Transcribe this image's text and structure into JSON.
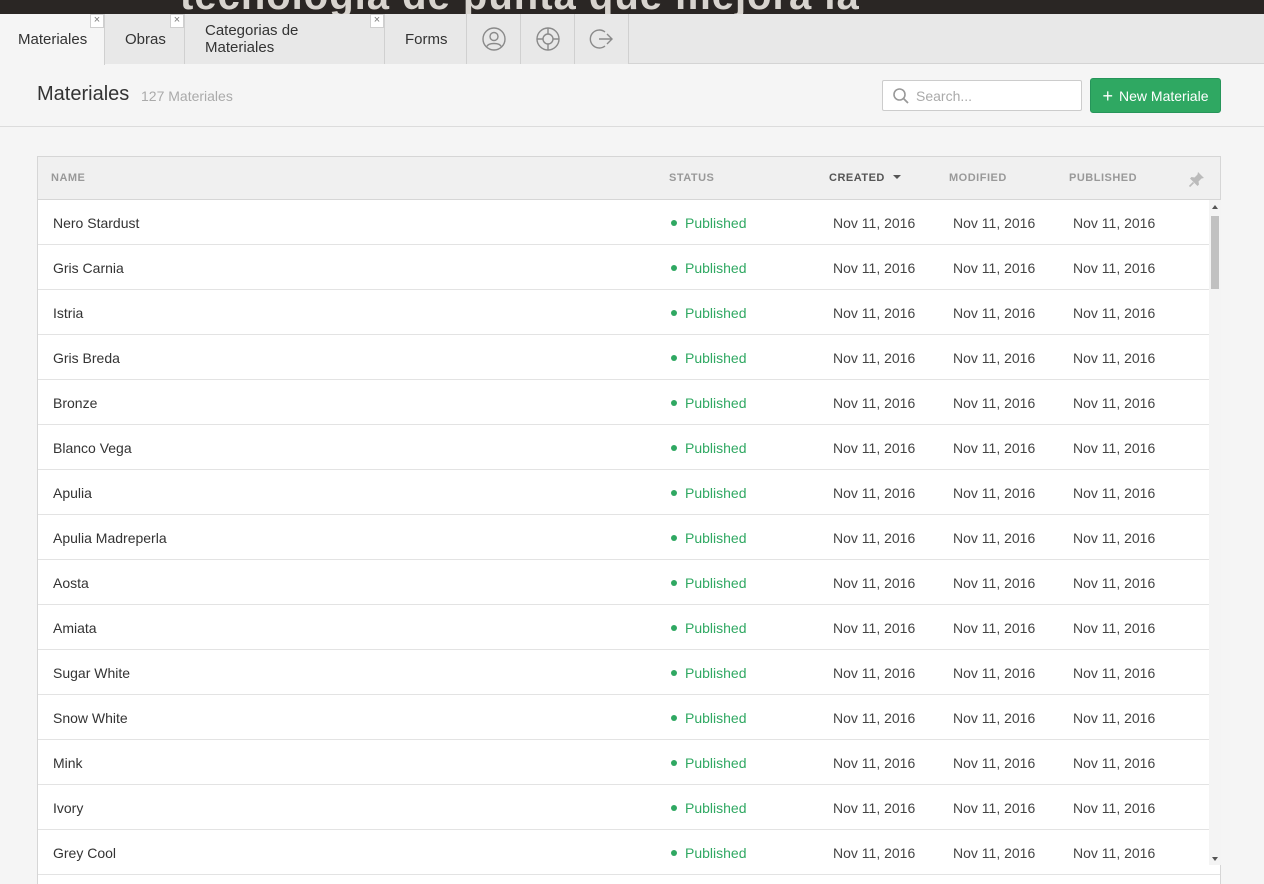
{
  "background_page": {
    "text": "tecnología de punta que mejora la"
  },
  "tabs": [
    {
      "label": "Materiales",
      "active": true,
      "closable": true
    },
    {
      "label": "Obras",
      "active": false,
      "closable": true
    },
    {
      "label": "Categorias de Materiales",
      "active": false,
      "closable": true
    },
    {
      "label": "Forms",
      "active": false,
      "closable": false
    }
  ],
  "tab_icons": [
    "user-icon",
    "help-lifebuoy-icon",
    "sign-out-icon"
  ],
  "header": {
    "title": "Materiales",
    "count": "127 Materiales",
    "search_placeholder": "Search...",
    "new_button": "New Materiale"
  },
  "table": {
    "columns": {
      "name": "NAME",
      "status": "STATUS",
      "created": "CREATED",
      "modified": "MODIFIED",
      "published": "PUBLISHED"
    },
    "sorted_by": "created",
    "rows": [
      {
        "name": "Nero Stardust",
        "status": "Published",
        "created": "Nov 11, 2016",
        "modified": "Nov 11, 2016",
        "published": "Nov 11, 2016"
      },
      {
        "name": "Gris Carnia",
        "status": "Published",
        "created": "Nov 11, 2016",
        "modified": "Nov 11, 2016",
        "published": "Nov 11, 2016"
      },
      {
        "name": "Istria",
        "status": "Published",
        "created": "Nov 11, 2016",
        "modified": "Nov 11, 2016",
        "published": "Nov 11, 2016"
      },
      {
        "name": "Gris Breda",
        "status": "Published",
        "created": "Nov 11, 2016",
        "modified": "Nov 11, 2016",
        "published": "Nov 11, 2016"
      },
      {
        "name": "Bronze",
        "status": "Published",
        "created": "Nov 11, 2016",
        "modified": "Nov 11, 2016",
        "published": "Nov 11, 2016"
      },
      {
        "name": "Blanco Vega",
        "status": "Published",
        "created": "Nov 11, 2016",
        "modified": "Nov 11, 2016",
        "published": "Nov 11, 2016"
      },
      {
        "name": "Apulia",
        "status": "Published",
        "created": "Nov 11, 2016",
        "modified": "Nov 11, 2016",
        "published": "Nov 11, 2016"
      },
      {
        "name": "Apulia Madreperla",
        "status": "Published",
        "created": "Nov 11, 2016",
        "modified": "Nov 11, 2016",
        "published": "Nov 11, 2016"
      },
      {
        "name": "Aosta",
        "status": "Published",
        "created": "Nov 11, 2016",
        "modified": "Nov 11, 2016",
        "published": "Nov 11, 2016"
      },
      {
        "name": "Amiata",
        "status": "Published",
        "created": "Nov 11, 2016",
        "modified": "Nov 11, 2016",
        "published": "Nov 11, 2016"
      },
      {
        "name": "Sugar White",
        "status": "Published",
        "created": "Nov 11, 2016",
        "modified": "Nov 11, 2016",
        "published": "Nov 11, 2016"
      },
      {
        "name": "Snow White",
        "status": "Published",
        "created": "Nov 11, 2016",
        "modified": "Nov 11, 2016",
        "published": "Nov 11, 2016"
      },
      {
        "name": "Mink",
        "status": "Published",
        "created": "Nov 11, 2016",
        "modified": "Nov 11, 2016",
        "published": "Nov 11, 2016"
      },
      {
        "name": "Ivory",
        "status": "Published",
        "created": "Nov 11, 2016",
        "modified": "Nov 11, 2016",
        "published": "Nov 11, 2016"
      },
      {
        "name": "Grey Cool",
        "status": "Published",
        "created": "Nov 11, 2016",
        "modified": "Nov 11, 2016",
        "published": "Nov 11, 2016"
      }
    ]
  },
  "colors": {
    "accent_green": "#2fa862",
    "tabbar_bg": "#e8e8e8",
    "page_bg": "#f5f5f5"
  }
}
